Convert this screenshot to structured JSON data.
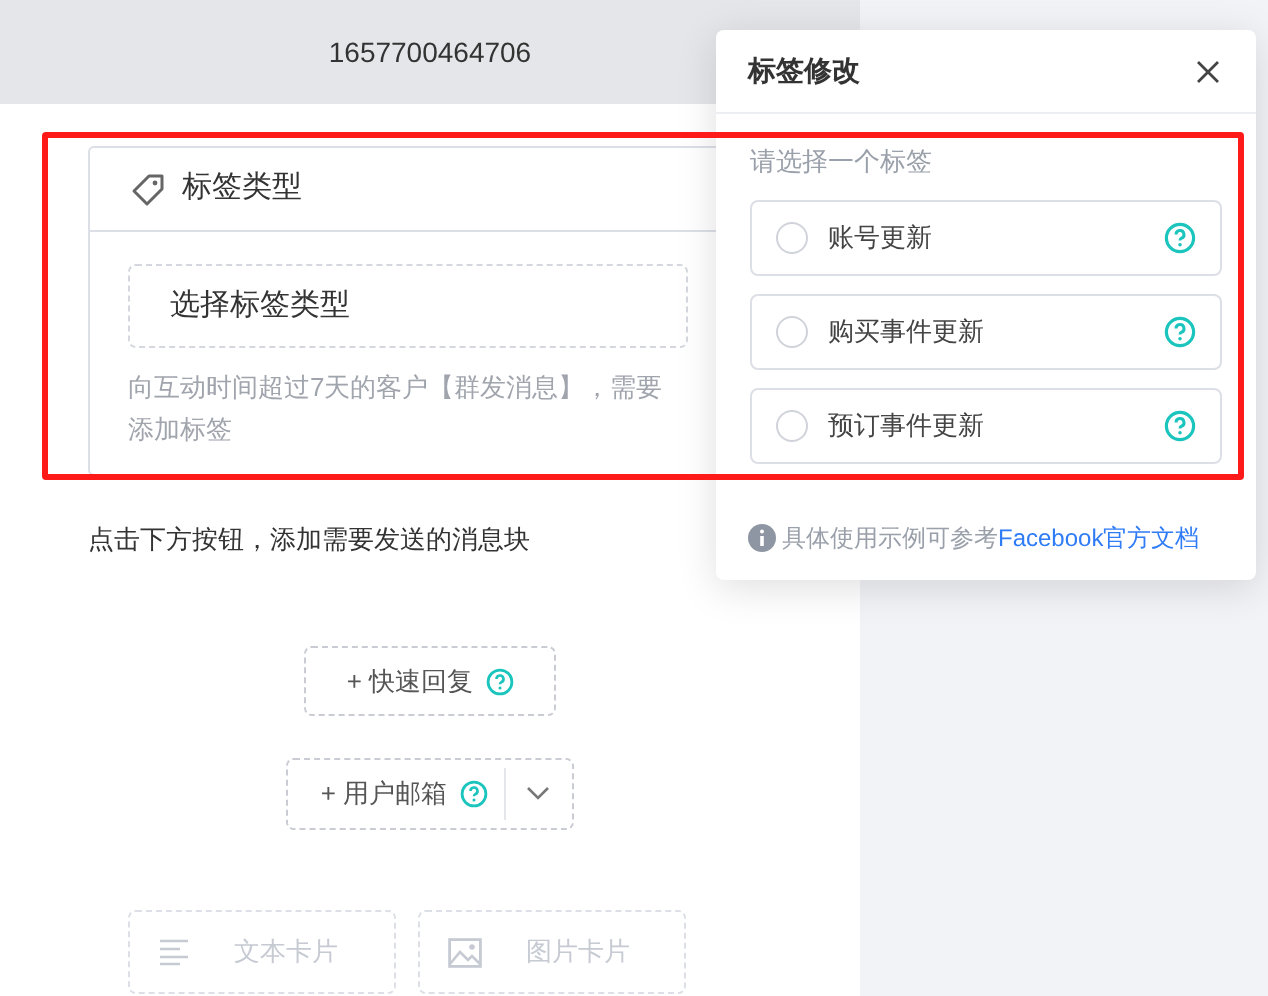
{
  "header": {
    "title": "1657700464706"
  },
  "tag_card": {
    "title": "标签类型",
    "select_label": "选择标签类型",
    "hint": "向互动时间超过7天的客户【群发消息】，需要添加标签"
  },
  "instruction": "点击下方按钮，添加需要发送的消息块",
  "blocks": [
    {
      "kind": "button",
      "label": "+ 快速回复"
    },
    {
      "kind": "split",
      "label": "+ 用户邮箱"
    }
  ],
  "cards": [
    {
      "kind": "text",
      "label": "文本卡片",
      "disabled": true
    },
    {
      "kind": "image",
      "label": "图片卡片",
      "disabled": true
    }
  ],
  "popover": {
    "title": "标签修改",
    "prompt": "请选择一个标签",
    "options": [
      {
        "label": "账号更新",
        "selected": false
      },
      {
        "label": "购买事件更新",
        "selected": false
      },
      {
        "label": "预订事件更新",
        "selected": false
      }
    ],
    "footer": {
      "text": "具体使用示例可参考",
      "link": "Facebook官方文档"
    }
  }
}
